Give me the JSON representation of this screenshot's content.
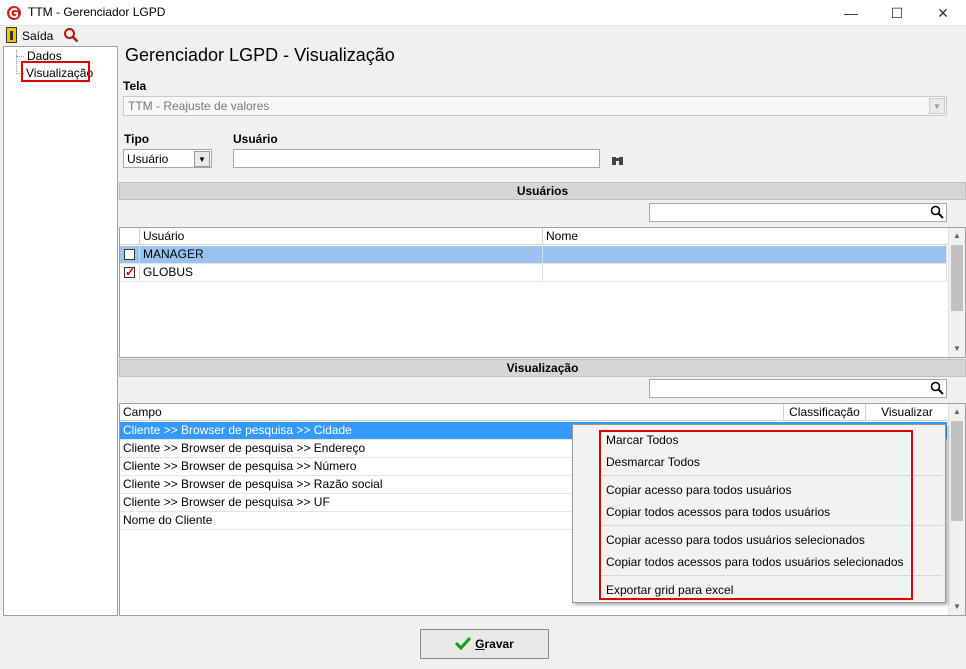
{
  "window": {
    "title": "TTM - Gerenciador LGPD",
    "minimize_glyph": "—",
    "maximize_glyph": "☐",
    "close_glyph": "✕"
  },
  "toolbar": {
    "exit_label": "Saída"
  },
  "tree": {
    "items": [
      {
        "label": "Dados"
      },
      {
        "label": "Visualização",
        "selected": true
      }
    ]
  },
  "page_title": "Gerenciador LGPD - Visualização",
  "tela": {
    "label": "Tela",
    "value": "TTM - Reajuste de valores"
  },
  "tipo": {
    "label": "Tipo",
    "value": "Usuário"
  },
  "usuario_field": {
    "label": "Usuário",
    "value": ""
  },
  "users_section": {
    "title": "Usuários",
    "search_value": "",
    "columns": [
      "Usuário",
      "Nome"
    ],
    "rows": [
      {
        "usuario": "MANAGER",
        "nome": "",
        "checked": false,
        "selected": true
      },
      {
        "usuario": "GLOBUS",
        "nome": "",
        "checked": true,
        "selected": false
      }
    ]
  },
  "view_section": {
    "title": "Visualização",
    "search_value": "",
    "columns": [
      "Campo",
      "Classificação",
      "Visualizar"
    ],
    "rows": [
      {
        "campo": "Cliente >> Browser de pesquisa >> Cidade",
        "selected": true
      },
      {
        "campo": "Cliente >> Browser de pesquisa >> Endereço"
      },
      {
        "campo": "Cliente >> Browser de pesquisa >> Número"
      },
      {
        "campo": "Cliente >> Browser de pesquisa >> Razão social"
      },
      {
        "campo": "Cliente >> Browser de pesquisa >> UF"
      },
      {
        "campo": "Nome do Cliente"
      }
    ]
  },
  "context_menu": {
    "items": [
      "Marcar Todos",
      "Desmarcar Todos",
      "Copiar acesso para todos usuários",
      "Copiar todos acessos para todos usuários",
      "Copiar acesso para todos usuários selecionados",
      "Copiar todos acessos para todos usuários selecionados",
      "Exportar grid para excel"
    ]
  },
  "save_button": {
    "mnemonic": "G",
    "rest": "ravar"
  },
  "colors": {
    "selection": "#3399ff",
    "highlight_box": "#e00000"
  }
}
